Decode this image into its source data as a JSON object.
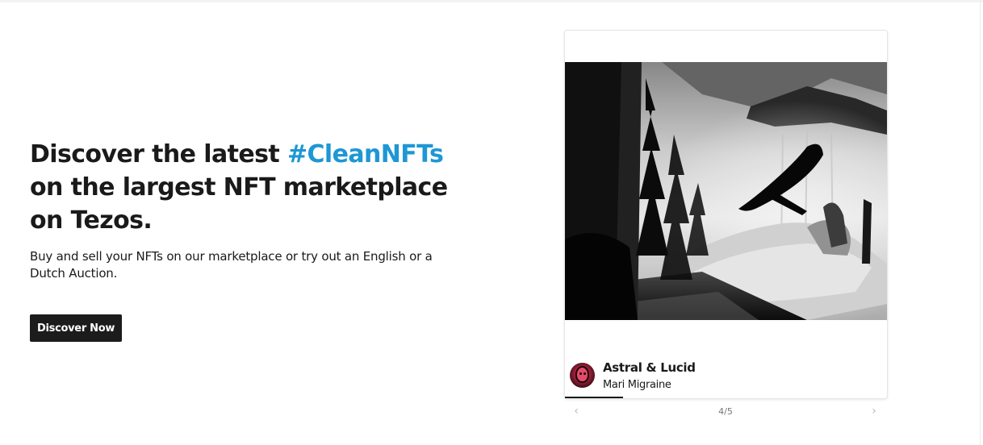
{
  "hero": {
    "title_part1": "Discover the latest ",
    "title_accent": "#CleanNFTs",
    "title_part2": " on the largest NFT marketplace on Tezos.",
    "subtitle": "Buy and sell your NFTs on our marketplace or try out an English or a Dutch Auction.",
    "cta_label": "Discover Now",
    "accent_color": "#1e97d4"
  },
  "carousel": {
    "item": {
      "title": "Astral & Lucid",
      "artist": "Mari Migraine"
    },
    "counter": "4/5",
    "progress": 0.18,
    "prev_icon": "chevron-left-icon",
    "next_icon": "chevron-right-icon"
  }
}
